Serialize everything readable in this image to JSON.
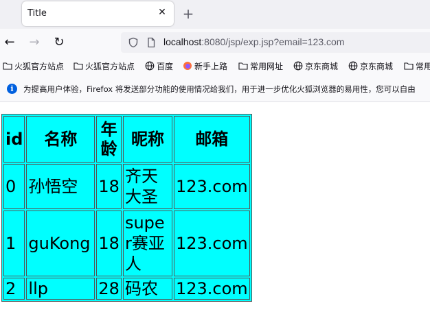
{
  "browser": {
    "tab": {
      "title": "Title",
      "close_glyph": "✕"
    },
    "new_tab_glyph": "+",
    "nav": {
      "back_glyph": "←",
      "forward_glyph": "→",
      "reload_glyph": "↻"
    },
    "url": {
      "host": "localhost",
      "rest": ":8080/jsp/exp.jsp?email=123.com"
    },
    "bookmarks": [
      {
        "label": "火狐官方站点",
        "icon": "folder-icon"
      },
      {
        "label": "火狐官方站点",
        "icon": "folder-icon"
      },
      {
        "label": "百度",
        "icon": "globe-icon"
      },
      {
        "label": "新手上路",
        "icon": "firefox-icon"
      },
      {
        "label": "常用网址",
        "icon": "folder-icon"
      },
      {
        "label": "京东商城",
        "icon": "globe-icon"
      },
      {
        "label": "京东商城",
        "icon": "globe-icon"
      },
      {
        "label": "常用",
        "icon": "folder-icon"
      }
    ],
    "infobar": {
      "icon": "info-icon",
      "text": "为提高用户体验，Firefox 将发送部分功能的使用情况给我们，用于进一步优化火狐浏览器的易用性，您可以自由"
    }
  },
  "table": {
    "headers": [
      "id",
      "名称",
      "年龄",
      "昵称",
      "邮箱"
    ],
    "rows": [
      [
        "0",
        "孙悟空",
        "18",
        "齐天大圣",
        "123.com"
      ],
      [
        "1",
        "guKong",
        "18",
        "super赛亚人",
        "123.com"
      ],
      [
        "2",
        "llp",
        "28",
        "码农",
        "123.com"
      ]
    ],
    "background_color": "#00ffff"
  },
  "colors": {
    "accent": "#0060df",
    "table_bg": "#00ffff"
  }
}
